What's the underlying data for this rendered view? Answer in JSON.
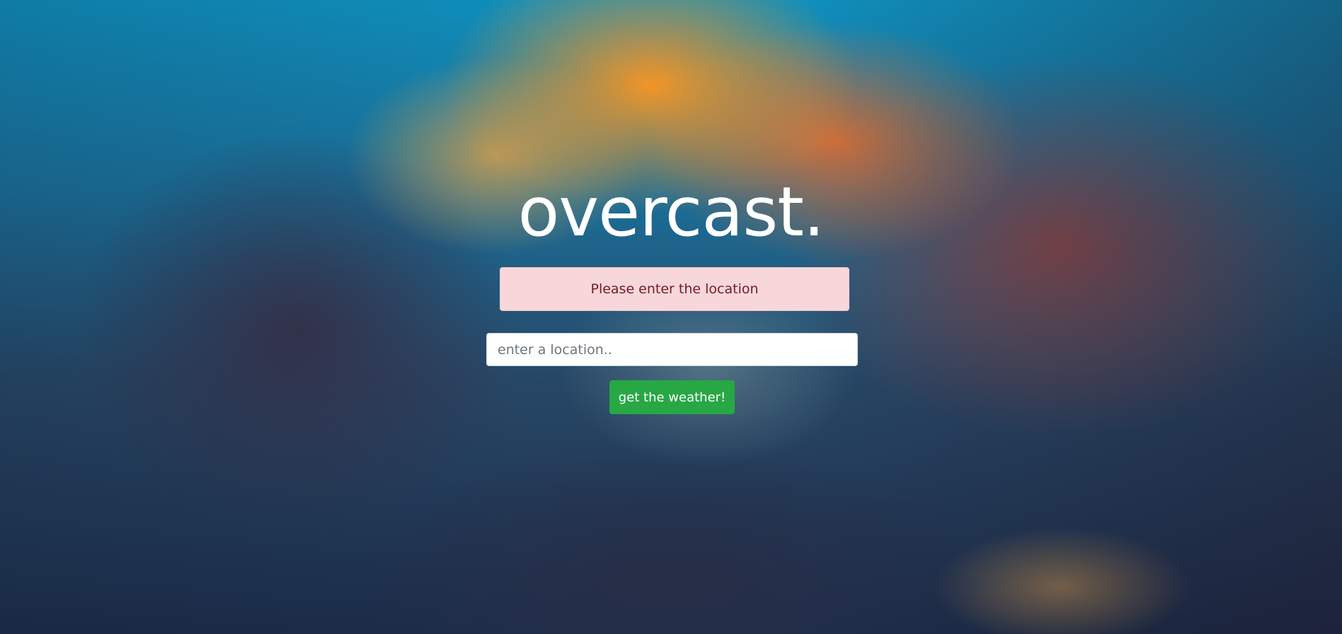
{
  "app": {
    "title": "overcast."
  },
  "alert": {
    "message": "Please enter the location",
    "color_bg": "#f8d7da",
    "color_text": "#721c24"
  },
  "search": {
    "placeholder": "enter a location..",
    "value": ""
  },
  "button": {
    "label": "get the weather!",
    "color": "#28a745"
  },
  "background": {
    "description_icon": "cloudy-sunset-sky-image"
  }
}
